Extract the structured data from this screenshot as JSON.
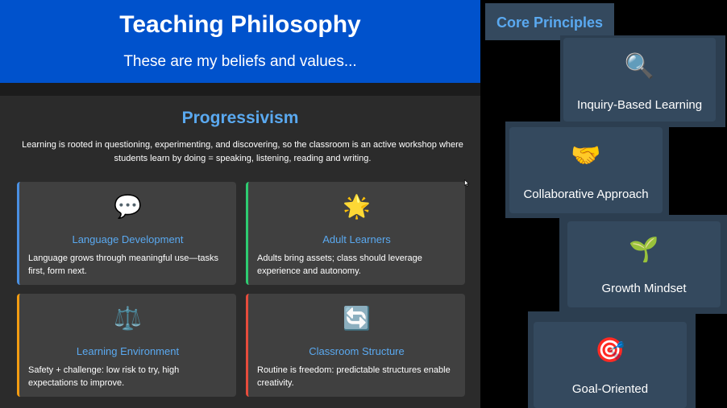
{
  "hero": {
    "title": "Teaching Philosophy",
    "subtitle": "These are my beliefs and values..."
  },
  "section": {
    "title": "Progressivism",
    "description": "Learning is rooted in questioning, experimenting, and discovering, so the classroom is an active workshop where students learn by doing = speaking, listening, reading and writing."
  },
  "cards": [
    {
      "emoji": "💬",
      "icon": "speech-bubble",
      "title": "Language Development",
      "description": "Language grows through meaningful use—tasks first, form next.",
      "accent": "#4a90e2"
    },
    {
      "emoji": "🌟",
      "icon": "star",
      "title": "Adult Learners",
      "description": "Adults bring assets; class should leverage experience and autonomy.",
      "accent": "#2ecc71"
    },
    {
      "emoji": "⚖️",
      "icon": "balance-scale",
      "title": "Learning Environment",
      "description": "Safety + challenge: low risk to try, high expectations to improve.",
      "accent": "#f39c12"
    },
    {
      "emoji": "🔄",
      "icon": "cycle-arrows",
      "title": "Classroom Structure",
      "description": "Routine is freedom: predictable structures enable creativity.",
      "accent": "#e74c3c"
    }
  ],
  "core": {
    "title": "Core Principles",
    "principles": [
      {
        "emoji": "🔍",
        "icon": "magnifying-glass",
        "label": "Inquiry-Based Learning"
      },
      {
        "emoji": "🤝",
        "icon": "handshake",
        "label": "Collaborative Approach"
      },
      {
        "emoji": "🌱",
        "icon": "seedling",
        "label": "Growth Mindset"
      },
      {
        "emoji": "🎯",
        "icon": "target",
        "label": "Goal-Oriented"
      }
    ]
  },
  "colors": {
    "hero_bg": "#0052cc",
    "accent_text": "#5aa9f0",
    "panel_bg": "#2b2b2b",
    "card_bg": "#404040",
    "principle_card_bg": "#34495e"
  }
}
